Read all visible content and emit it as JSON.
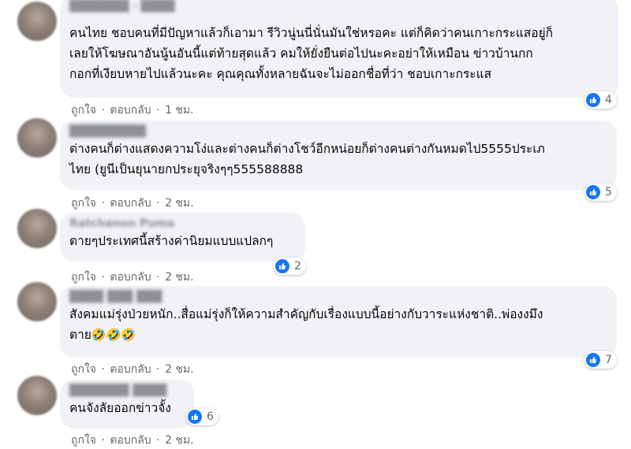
{
  "comments": [
    {
      "text": "คนไทย ชอบคนที่มีปัญหาแล้วก็เอามา รีวิวนู่นนี่นั่นมันใช่หรอคะ แต่ก็คิดว่าคนเกาะกระแสอยู่ก็\nเลยให้โฆษณาอันนู้นอันนี้แต่ท้ายสุดแล้ว คมให้ยั่งยืนต่อไปนะคะอย่าให้เหมือน ข่าวบ้านกก\nกอกที่เงียบหายไปแล้วนะคะ คุณคุณทั้งหลายฉันจะไม่ออกชื่อที่ว่า ชอบเกาะกระแส",
      "like": "ถูกใจ",
      "reply": "ตอบกลับ",
      "time": "1 ชม.",
      "reactions": "4"
    },
    {
      "text": "ต่างคนก็ต่างแสดงความโง่และต่างคนก็ต่างโชว์อีกหน่อยก็ต่างคนต่างกันหมดไป5555ประเภ\nไทย (ยูนีเป็นยุนายกประยุจริงๆๆ555588888",
      "like": "ถูกใจ",
      "reply": "ตอบกลับ",
      "time": "2 ชม.",
      "reactions": "5"
    },
    {
      "name": "Ratchanon Puma",
      "text": "ตายๆประเทศนี้สร้างค่านิยมแบบแปลกๆ",
      "like": "ถูกใจ",
      "reply": "ตอบกลับ",
      "time": "2 ชม.",
      "reactions": "2"
    },
    {
      "text": "สังคมแม่รุ่งป่วยหนัก..สื่อแม่รุ่งก็ให้ความสำคัญกับเรื่องแบบนี้อย่างกับวาระแห่งชาติ..พ่องงมึง\nตาย",
      "emoji": "🤣🤣🤣",
      "like": "ถูกใจ",
      "reply": "ตอบกลับ",
      "time": "2 ชม.",
      "reactions": "7"
    },
    {
      "text": "คนจังลัยออกข่าวจั้ง",
      "like": "ถูกใจ",
      "reply": "ตอบกลับ",
      "time": "2 ชม.",
      "reactions": "6"
    }
  ],
  "separator": "·",
  "colors": {
    "bubble": "#f0f2f5",
    "like_blue": "#1877f2",
    "meta_gray": "#65676b"
  },
  "icons": {
    "reaction": "like-icon"
  }
}
